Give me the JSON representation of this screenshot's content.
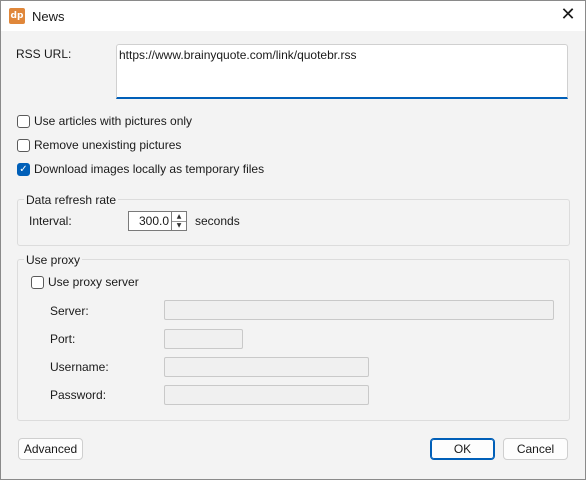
{
  "window": {
    "title": "News",
    "app_icon": "dp",
    "close_glyph": "✕"
  },
  "rss": {
    "label": "RSS URL:",
    "value": "https://www.brainyquote.com/link/quotebr.rss"
  },
  "options": [
    {
      "label": "Use articles with pictures only",
      "checked": false
    },
    {
      "label": "Remove unexisting pictures",
      "checked": false
    },
    {
      "label": "Download images locally as temporary files",
      "checked": true
    }
  ],
  "refresh": {
    "group_title": "Data refresh rate",
    "interval_label": "Interval:",
    "interval_value": "300.0",
    "unit": "seconds"
  },
  "proxy": {
    "group_title": "Use proxy",
    "use_label": "Use proxy server",
    "use_checked": false,
    "server_label": "Server:",
    "port_label": "Port:",
    "username_label": "Username:",
    "password_label": "Password:"
  },
  "buttons": {
    "advanced": "Advanced",
    "ok": "OK",
    "cancel": "Cancel"
  },
  "colors": {
    "accent": "#005fb8",
    "app_icon": "#e0873a"
  }
}
